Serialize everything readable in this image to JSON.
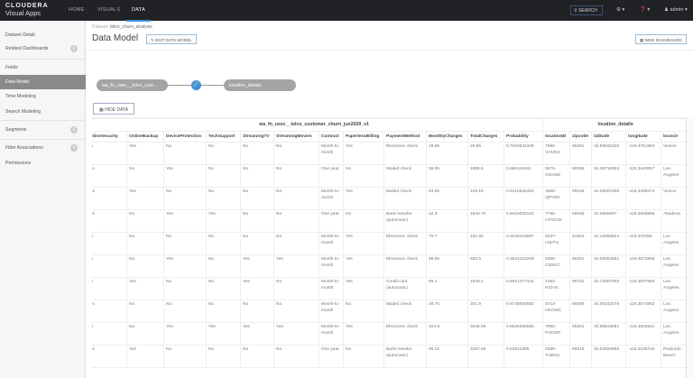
{
  "nav": {
    "brand_top": "CLOUDERA",
    "brand_bottom": "Visual Apps",
    "links": [
      "HOME",
      "VISUALS",
      "DATA"
    ],
    "search": "SEARCH",
    "user": "admin"
  },
  "sidebar": {
    "items": [
      {
        "label": "Dataset Detail"
      },
      {
        "label": "Related Dashboards",
        "badge": "0"
      },
      {
        "label": "Fields"
      },
      {
        "label": "Data Model"
      },
      {
        "label": "Time Modeling"
      },
      {
        "label": "Search Modeling"
      },
      {
        "label": "Segments",
        "badge": "0"
      },
      {
        "label": "Filter Associations",
        "badge": "0"
      },
      {
        "label": "Permissions"
      }
    ]
  },
  "header": {
    "crumb_label": "Dataset:",
    "crumb_value": "telco_churn_analysis",
    "title": "Data Model",
    "edit_button": "EDIT DATA MODEL",
    "new_dashboard_button": "NEW DASHBOARD"
  },
  "model": {
    "left_node": "wa_fn_usec__telco_cust...",
    "right_node": "location_details",
    "hide_data_button": "HIDE DATA"
  },
  "table": {
    "groups": [
      {
        "label": "wa_fn_usec__telco_customer_churn_jun2020_v1",
        "span": 12
      },
      {
        "label": "location_details",
        "span": 5
      }
    ],
    "columns": [
      "OnlineSecurity",
      "OnlineBackup",
      "DeviceProtection",
      "TechSupport",
      "StreamingTV",
      "StreamingMovies",
      "Contract",
      "PaperlessBilling",
      "PaymentMethod",
      "MonthlyCharges",
      "TotalCharges_",
      "Probability",
      "locationID",
      "zipcode",
      "latitude",
      "longitude",
      "branch"
    ],
    "rows": [
      [
        "No",
        "Yes",
        "No",
        "No",
        "No",
        "No",
        "Month-to-month",
        "Yes",
        "Electronic check",
        "29.85",
        "29.85",
        "0.7620834349",
        "7590-VHVEG",
        "90291",
        "33.99820328",
        "-118.4761963",
        "Venice"
      ],
      [
        "Yes",
        "No",
        "Yes",
        "No",
        "No",
        "No",
        "One year",
        "No",
        "Mailed check",
        "56.95",
        "1889.5",
        "0.884119184",
        "5575-GNVDE",
        "90046",
        "34.08716583",
        "-118.3440857",
        "Los Angeles"
      ],
      [
        "Yes",
        "Yes",
        "No",
        "No",
        "No",
        "No",
        "Month-to-month",
        "Yes",
        "Mailed check",
        "53.85",
        "108.15",
        "0.9410526452",
        "3668-QPYBK",
        "90046",
        "34.09407806",
        "-118.3499374",
        "Venice"
      ],
      [
        "Yes",
        "No",
        "Yes",
        "Yes",
        "No",
        "No",
        "One year",
        "No",
        "Bank transfer (automatic)",
        "42.3",
        "1840.75",
        "0.9419005153",
        "7795-CFOCW",
        "90048",
        "34.0685997",
        "-118.3636856",
        "Altadena"
      ],
      [
        "No",
        "No",
        "No",
        "No",
        "No",
        "No",
        "Month-to-month",
        "Yes",
        "Electronic check",
        "70.7",
        "151.65",
        "0.4545163587",
        "9237-HQITU",
        "91601",
        "34.16056824",
        "-118.376358",
        "Los Angeles"
      ],
      [
        "No",
        "No",
        "Yes",
        "No",
        "Yes",
        "Yes",
        "Month-to-month",
        "Yes",
        "Electronic check",
        "99.65",
        "820.5",
        "0.3541024209",
        "9305-CDSKC",
        "90291",
        "34.00062561",
        "-118.4673996",
        "Los Angeles"
      ],
      [
        "No",
        "Yes",
        "No",
        "No",
        "Yes",
        "No",
        "Month-to-month",
        "Yes",
        "Credit card (automatic)",
        "89.1",
        "1949.4",
        "0.6921477444",
        "1452-KIOVK",
        "90731",
        "33.72607803",
        "-118.3007965",
        "Los Angeles"
      ],
      [
        "Yes",
        "No",
        "No",
        "No",
        "No",
        "No",
        "Month-to-month",
        "No",
        "Mailed check",
        "29.75",
        "301.9",
        "0.6746694582",
        "6713-OKOMC",
        "90008",
        "34.00243378",
        "-118.3574982",
        "Los Angeles"
      ],
      [
        "No",
        "No",
        "Yes",
        "Yes",
        "Yes",
        "Yes",
        "Month-to-month",
        "Yes",
        "Electronic check",
        "104.8",
        "3046.05",
        "0.8845256555",
        "7892-POOKP",
        "90291",
        "33.98816681",
        "-118.4633942",
        "Los Angeles"
      ],
      [
        "Yes",
        "Yes",
        "No",
        "No",
        "No",
        "No",
        "One year",
        "No",
        "Bank transfer (automatic)",
        "56.15",
        "3487.95",
        "0.52542396",
        "6388-TABGU",
        "90019",
        "34.04566956",
        "-118.3136749",
        "Redondo Beach"
      ]
    ]
  }
}
